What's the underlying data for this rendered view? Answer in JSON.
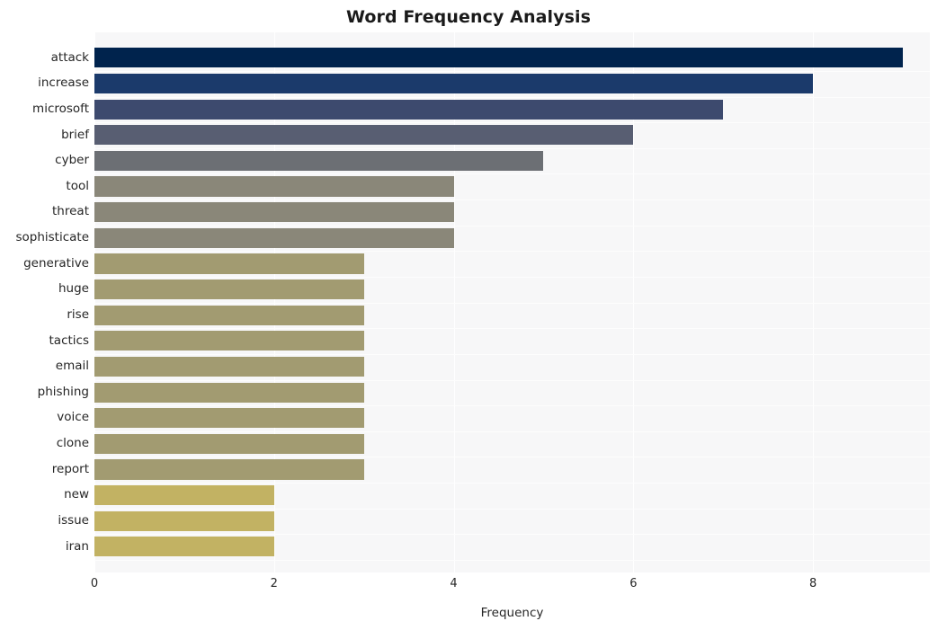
{
  "chart_data": {
    "type": "bar",
    "orientation": "horizontal",
    "title": "Word Frequency Analysis",
    "xlabel": "Frequency",
    "ylabel": "",
    "xlim": [
      0,
      9.3
    ],
    "xticks": [
      "0",
      "2",
      "4",
      "6",
      "8"
    ],
    "xtick_values": [
      0,
      2,
      4,
      6,
      8
    ],
    "grid": true,
    "grid_axis": "x",
    "legend": "none",
    "categories": [
      "attack",
      "increase",
      "microsoft",
      "brief",
      "cyber",
      "tool",
      "threat",
      "sophisticate",
      "generative",
      "huge",
      "rise",
      "tactics",
      "email",
      "phishing",
      "voice",
      "clone",
      "report",
      "new",
      "issue",
      "iran"
    ],
    "values": [
      9,
      8,
      7,
      6,
      5,
      4,
      4,
      4,
      3,
      3,
      3,
      3,
      3,
      3,
      3,
      3,
      3,
      2,
      2,
      2
    ],
    "bar_colors": [
      "#00234d",
      "#1b3a6b",
      "#3d4a6e",
      "#585e72",
      "#6c6f74",
      "#8a8779",
      "#8a8779",
      "#8a8779",
      "#a29b71",
      "#a29b71",
      "#a29b71",
      "#a29b71",
      "#a29b71",
      "#a29b71",
      "#a29b71",
      "#a29b71",
      "#a29b71",
      "#c2b263",
      "#c2b263",
      "#c2b263"
    ],
    "plot_background": "#f7f7f8",
    "figure_background": "#ffffff",
    "gridline_color": "#ffffff",
    "text_color": "#262626",
    "title_color": "#1a1a1a"
  }
}
